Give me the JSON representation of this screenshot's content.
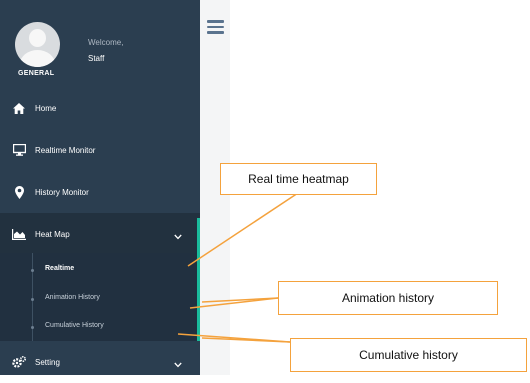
{
  "profile": {
    "role": "GENERAL",
    "welcome": "Welcome,",
    "name": "Staff"
  },
  "menu": {
    "items": [
      {
        "label": "Home",
        "icon": "home-icon"
      },
      {
        "label": "Realtime Monitor",
        "icon": "monitor-icon"
      },
      {
        "label": "History Monitor",
        "icon": "map-marker-icon"
      },
      {
        "label": "Heat Map",
        "icon": "area-chart-icon",
        "expanded": true
      },
      {
        "label": "Setting",
        "icon": "cogs-icon"
      }
    ],
    "heat_map_sub": [
      {
        "label": "Realtime",
        "active": true
      },
      {
        "label": "Animation History",
        "active": false
      },
      {
        "label": "Cumulative History",
        "active": false
      }
    ]
  },
  "callouts": {
    "realtime": "Real time heatmap",
    "animation": "Animation history",
    "cumulative": "Cumulative history"
  },
  "colors": {
    "sidebar": "#2b3e50",
    "accent": "#1abb9c",
    "callout_border": "#f4a23d"
  }
}
